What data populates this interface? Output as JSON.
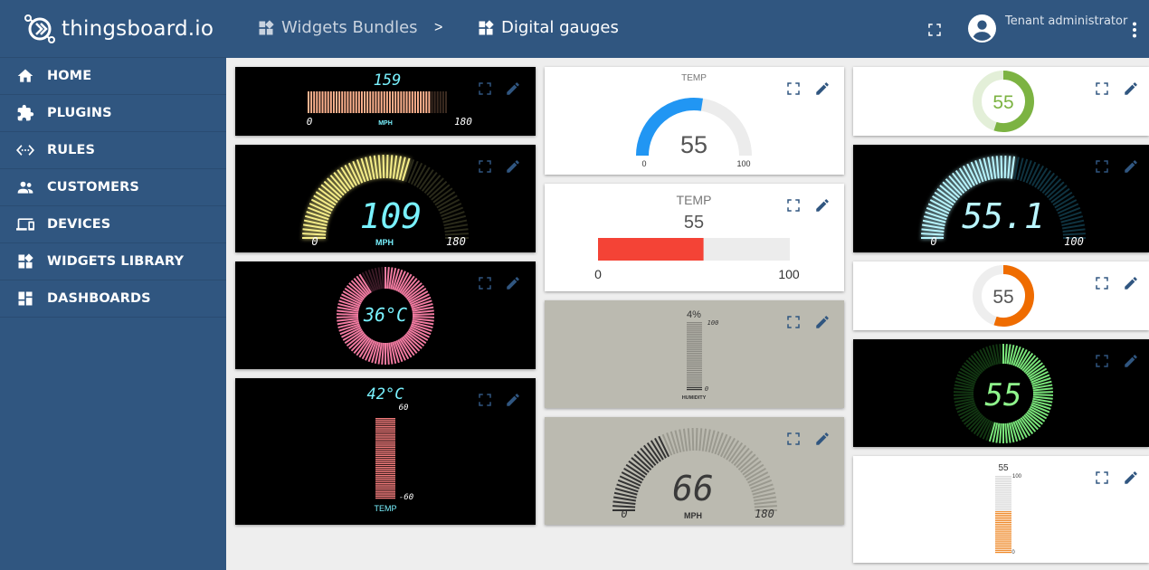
{
  "app": {
    "logo_text": "thingsboard.io"
  },
  "sidebar": {
    "items": [
      {
        "label": "HOME",
        "icon": "home-icon"
      },
      {
        "label": "PLUGINS",
        "icon": "puzzle-icon"
      },
      {
        "label": "RULES",
        "icon": "settings-ethernet-icon"
      },
      {
        "label": "CUSTOMERS",
        "icon": "people-icon"
      },
      {
        "label": "DEVICES",
        "icon": "devices-icon"
      },
      {
        "label": "WIDGETS LIBRARY",
        "icon": "widgets-icon"
      },
      {
        "label": "DASHBOARDS",
        "icon": "dashboard-icon"
      }
    ]
  },
  "header": {
    "breadcrumb_1": "Widgets Bundles",
    "separator": ">",
    "breadcrumb_2": "Digital gauges",
    "user_role": "Tenant administrator"
  },
  "widgets": {
    "w1": {
      "value": "159",
      "min": "0",
      "max": "180",
      "unit": "MPH",
      "level": 0.88
    },
    "w2": {
      "value": "109",
      "min": "0",
      "max": "180",
      "unit": "MPH",
      "level": 0.6
    },
    "w3": {
      "value": "36°C"
    },
    "w4": {
      "value": "42°C",
      "max": "60",
      "min": "-60",
      "label": "TEMP"
    },
    "w5": {
      "title": "TEMP",
      "value": "55",
      "min": "0",
      "max": "100",
      "level": 0.55
    },
    "w6": {
      "title": "TEMP",
      "value": "55",
      "min": "0",
      "max": "100",
      "level": 0.55
    },
    "w7": {
      "value": "4%",
      "max": "100",
      "min": "0",
      "label": "HUMIDITY",
      "level": 0.04
    },
    "w8": {
      "value": "66",
      "min": "0",
      "max": "180",
      "unit": "MPH",
      "level": 0.37
    },
    "w9": {
      "value": "55",
      "level": 0.55
    },
    "w10": {
      "value": "55.1",
      "min": "0",
      "max": "100",
      "level": 0.551
    },
    "w11": {
      "value": "55",
      "level": 0.55
    },
    "w12": {
      "value": "55",
      "level": 0.55
    },
    "w13": {
      "value": "55",
      "max": "100",
      "min": "0",
      "level": 0.55
    }
  },
  "colors": {
    "brand": "#305680",
    "background": "#eeeeee",
    "blue_gauge": "#2196f3",
    "red_bar": "#f44336",
    "green_donut": "#7cb342",
    "orange_donut": "#ef6c00",
    "orange_bar": "#ef8a2a"
  }
}
